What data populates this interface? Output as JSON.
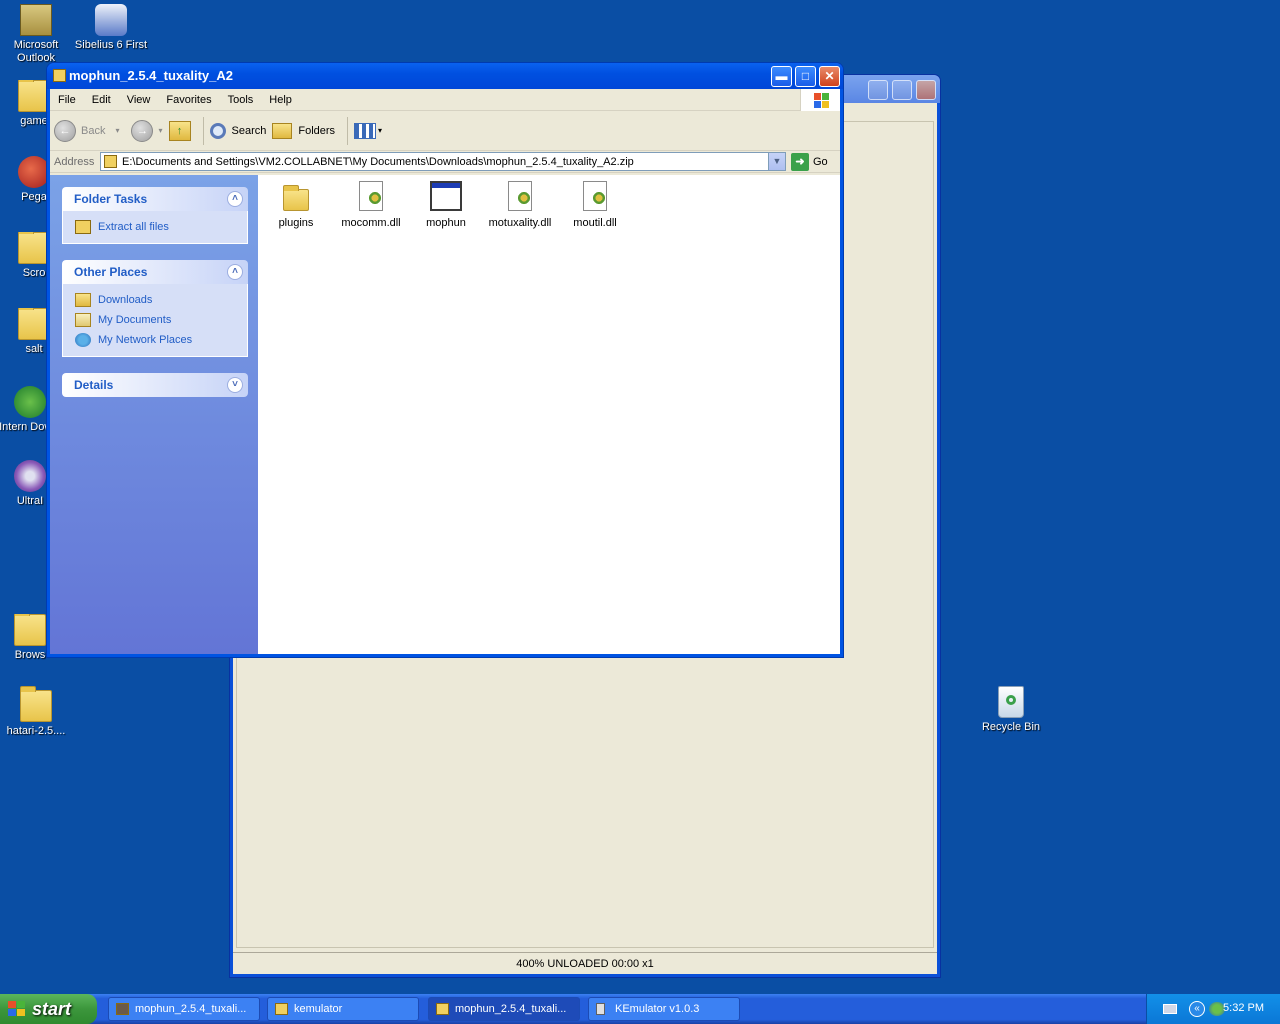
{
  "desktop": {
    "icons": [
      {
        "label": "Microsoft Outlook",
        "icon": "outlook-icon"
      },
      {
        "label": "Sibelius 6 First",
        "icon": "sibelius-icon"
      },
      {
        "label": "game",
        "icon": "folder-icon"
      },
      {
        "label": "Pega",
        "icon": "pegasus-icon"
      },
      {
        "label": "Scro",
        "icon": "folder-icon"
      },
      {
        "label": "salt",
        "icon": "folder-icon"
      },
      {
        "label": "Intern Downl",
        "icon": "download-manager-icon"
      },
      {
        "label": "UltraI",
        "icon": "ultraiso-icon"
      },
      {
        "label": "Brows",
        "icon": "folder-icon"
      },
      {
        "label": "hatari-2.5....",
        "icon": "folder-icon"
      },
      {
        "label": "Recycle Bin",
        "icon": "recycle-bin-icon"
      }
    ]
  },
  "background_window": {
    "status": "400%  UNLOADED  00:00  x1"
  },
  "explorer": {
    "title": "mophun_2.5.4_tuxality_A2",
    "menu": [
      "File",
      "Edit",
      "View",
      "Favorites",
      "Tools",
      "Help"
    ],
    "toolbar": {
      "back": "Back",
      "search": "Search",
      "folders": "Folders"
    },
    "address": {
      "label": "Address",
      "value": "E:\\Documents and Settings\\VM2.COLLABNET\\My Documents\\Downloads\\mophun_2.5.4_tuxality_A2.zip",
      "go": "Go"
    },
    "tasks": {
      "folder_tasks": {
        "title": "Folder Tasks",
        "items": [
          "Extract all files"
        ]
      },
      "other_places": {
        "title": "Other Places",
        "items": [
          "Downloads",
          "My Documents",
          "My Network Places"
        ]
      },
      "details": {
        "title": "Details"
      }
    },
    "files": [
      {
        "name": "plugins",
        "type": "folder"
      },
      {
        "name": "mocomm.dll",
        "type": "dll"
      },
      {
        "name": "mophun",
        "type": "exe"
      },
      {
        "name": "motuxality.dll",
        "type": "dll"
      },
      {
        "name": "moutil.dll",
        "type": "dll"
      }
    ]
  },
  "taskbar": {
    "start": "start",
    "tasks": [
      {
        "label": "mophun_2.5.4_tuxali...",
        "active": false
      },
      {
        "label": "kemulator",
        "active": false
      },
      {
        "label": "mophun_2.5.4_tuxali...",
        "active": true
      },
      {
        "label": "KEmulator v1.0.3",
        "active": false
      }
    ],
    "clock": "5:32 PM"
  },
  "colors": {
    "desktop": "#0a4ea4",
    "titlebar": "#0054e3",
    "taskpane_link": "#215dc6",
    "start_button": "#3c963c"
  }
}
